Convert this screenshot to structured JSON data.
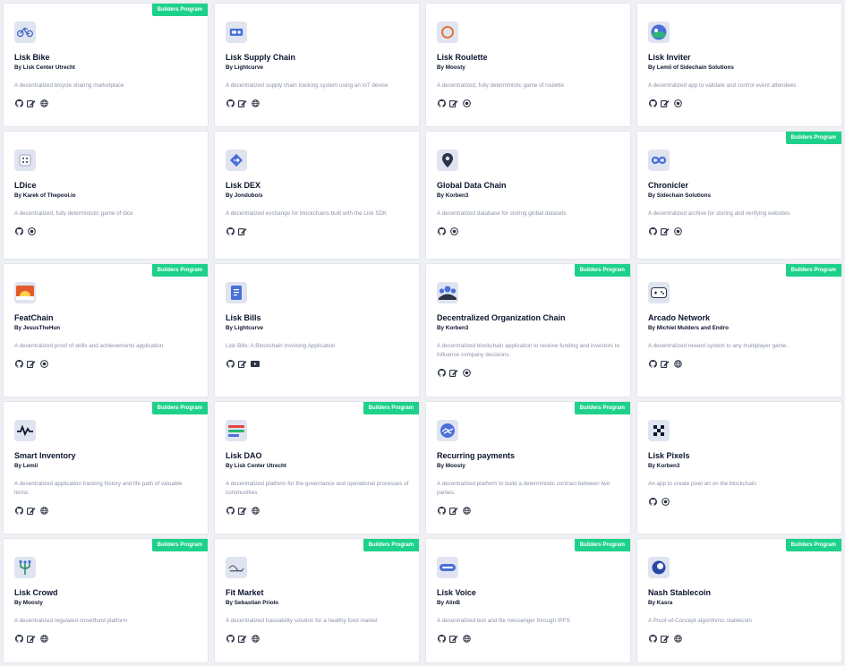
{
  "badge_label": "Builders Program",
  "colors": {
    "badge": "#1ed18b",
    "title": "#0c152e",
    "desc": "#8a93a6",
    "icon": "#2c3344"
  },
  "cards": [
    {
      "title": "Lisk Bike",
      "author": "By Lisk Center Utrecht",
      "description": "A decentralized bicycle sharing marketplace",
      "badge": true,
      "logo_icon": "bike-icon",
      "links": [
        "github-icon",
        "docs-icon",
        "website-icon"
      ]
    },
    {
      "title": "Lisk Supply Chain",
      "author": "By Lightcurve",
      "description": "A decentralized supply chain tracking system using an IoT device",
      "badge": false,
      "logo_icon": "truck-icon",
      "links": [
        "github-icon",
        "docs-icon",
        "website-icon"
      ]
    },
    {
      "title": "Lisk Roulette",
      "author": "By Moosty",
      "description": "A decentralized, fully deterministic game of roulette",
      "badge": false,
      "logo_icon": "roulette-icon",
      "links": [
        "github-icon",
        "docs-icon",
        "demo-icon"
      ]
    },
    {
      "title": "Lisk Inviter",
      "author": "By Lemii of Sidechain Solutions",
      "description": "A decentralized app to validate and control event attendees",
      "badge": false,
      "logo_icon": "globe-logo-icon",
      "links": [
        "github-icon",
        "docs-icon",
        "demo-icon"
      ]
    },
    {
      "title": "LDice",
      "author": "By Karek of Thepool.io",
      "description": "A decentralized, fully deterministic game of dice",
      "badge": false,
      "logo_icon": "dice-icon",
      "links": [
        "github-icon",
        "demo-icon"
      ]
    },
    {
      "title": "Lisk DEX",
      "author": "By Jondubois",
      "description": "A decentralized exchange for blockchains built with the Lisk SDK",
      "badge": false,
      "logo_icon": "exchange-icon",
      "links": [
        "github-icon",
        "docs-icon"
      ]
    },
    {
      "title": "Global Data Chain",
      "author": "By Korben3",
      "description": "A decentralized database for storing global datasets",
      "badge": false,
      "logo_icon": "map-pin-icon",
      "links": [
        "github-icon",
        "demo-icon"
      ]
    },
    {
      "title": "Chronicler",
      "author": "By Sidechain Solutions",
      "description": "A decentralized archive for storing and verifying websites",
      "badge": true,
      "logo_icon": "infinity-icon",
      "links": [
        "github-icon",
        "docs-icon",
        "demo-icon"
      ]
    },
    {
      "title": "FeatChain",
      "author": "By JesusTheHun",
      "description": "A decentralized proof of skills and achievements application",
      "badge": true,
      "logo_icon": "sunrise-icon",
      "links": [
        "github-icon",
        "docs-icon",
        "demo-icon"
      ]
    },
    {
      "title": "Lisk Bills",
      "author": "By Lightcurve",
      "description": "Lisk Bills: A Blockchain Invoicing Application",
      "badge": false,
      "logo_icon": "invoice-icon",
      "links": [
        "github-icon",
        "docs-icon",
        "video-icon"
      ]
    },
    {
      "title": "Decentralized Organization Chain",
      "author": "By Korben3",
      "description": "A decentralized blockchain application to receive funding and investors to influence company decisions.",
      "badge": true,
      "logo_icon": "people-icon",
      "links": [
        "github-icon",
        "docs-icon",
        "demo-icon"
      ]
    },
    {
      "title": "Arcado Network",
      "author": "By Michiel Mulders and Endro",
      "description": "A decentralized reward system to any multiplayer game.",
      "badge": true,
      "logo_icon": "gamepad-icon",
      "links": [
        "github-icon",
        "docs-icon",
        "website-icon"
      ]
    },
    {
      "title": "Smart Inventory",
      "author": "By Lemii",
      "description": "A decentralized application tracking history and life path of valuable items.",
      "badge": true,
      "logo_icon": "pulse-icon",
      "links": [
        "github-icon",
        "docs-icon",
        "website-icon"
      ]
    },
    {
      "title": "Lisk DAO",
      "author": "By Lisk Center Utrecht",
      "description": "A decentralized platform for the governance and operational processes of communities",
      "badge": true,
      "logo_icon": "dao-icon",
      "links": [
        "github-icon",
        "docs-icon",
        "website-icon"
      ]
    },
    {
      "title": "Recurring payments",
      "author": "By Moosty",
      "description": "A decentralized platform to build a deterministic contract between two parties.",
      "badge": true,
      "logo_icon": "handshake-icon",
      "links": [
        "github-icon",
        "docs-icon",
        "website-icon"
      ]
    },
    {
      "title": "Lisk Pixels",
      "author": "By Korben3",
      "description": "An app to create pixel art on the blockchain.",
      "badge": false,
      "logo_icon": "pixel-icon",
      "links": [
        "github-icon",
        "demo-icon"
      ]
    },
    {
      "title": "Lisk Crowd",
      "author": "By Moosty",
      "description": "A decentralized regulated crowdfund platform",
      "badge": true,
      "logo_icon": "trident-icon",
      "links": [
        "github-icon",
        "docs-icon",
        "website-icon"
      ]
    },
    {
      "title": "Fit Market",
      "author": "By Sebastian Priolo",
      "description": "A decentralized traceability solution for a healthy food market",
      "badge": true,
      "logo_icon": "fit-market-icon",
      "links": [
        "github-icon",
        "docs-icon",
        "website-icon"
      ]
    },
    {
      "title": "Lisk Voice",
      "author": "By AlinB",
      "description": "A decentralized text and file messenger through IPFS",
      "badge": true,
      "logo_icon": "chat-icon",
      "links": [
        "github-icon",
        "docs-icon",
        "website-icon"
      ]
    },
    {
      "title": "Nash Stablecoin",
      "author": "By Kasra",
      "description": "A Proof-of-Concept algorithmic stablecoin",
      "badge": true,
      "logo_icon": "coin-icon",
      "links": [
        "github-icon",
        "docs-icon",
        "website-icon"
      ]
    }
  ]
}
